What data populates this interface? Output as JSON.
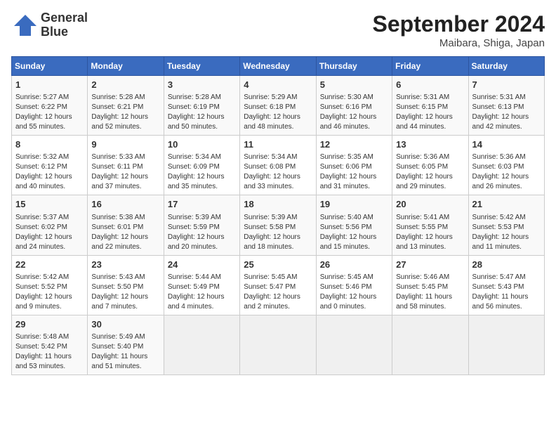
{
  "header": {
    "logo_line1": "General",
    "logo_line2": "Blue",
    "title": "September 2024",
    "subtitle": "Maibara, Shiga, Japan"
  },
  "weekdays": [
    "Sunday",
    "Monday",
    "Tuesday",
    "Wednesday",
    "Thursday",
    "Friday",
    "Saturday"
  ],
  "weeks": [
    [
      {
        "day": "1",
        "lines": [
          "Sunrise: 5:27 AM",
          "Sunset: 6:22 PM",
          "Daylight: 12 hours",
          "and 55 minutes."
        ]
      },
      {
        "day": "2",
        "lines": [
          "Sunrise: 5:28 AM",
          "Sunset: 6:21 PM",
          "Daylight: 12 hours",
          "and 52 minutes."
        ]
      },
      {
        "day": "3",
        "lines": [
          "Sunrise: 5:28 AM",
          "Sunset: 6:19 PM",
          "Daylight: 12 hours",
          "and 50 minutes."
        ]
      },
      {
        "day": "4",
        "lines": [
          "Sunrise: 5:29 AM",
          "Sunset: 6:18 PM",
          "Daylight: 12 hours",
          "and 48 minutes."
        ]
      },
      {
        "day": "5",
        "lines": [
          "Sunrise: 5:30 AM",
          "Sunset: 6:16 PM",
          "Daylight: 12 hours",
          "and 46 minutes."
        ]
      },
      {
        "day": "6",
        "lines": [
          "Sunrise: 5:31 AM",
          "Sunset: 6:15 PM",
          "Daylight: 12 hours",
          "and 44 minutes."
        ]
      },
      {
        "day": "7",
        "lines": [
          "Sunrise: 5:31 AM",
          "Sunset: 6:13 PM",
          "Daylight: 12 hours",
          "and 42 minutes."
        ]
      }
    ],
    [
      {
        "day": "8",
        "lines": [
          "Sunrise: 5:32 AM",
          "Sunset: 6:12 PM",
          "Daylight: 12 hours",
          "and 40 minutes."
        ]
      },
      {
        "day": "9",
        "lines": [
          "Sunrise: 5:33 AM",
          "Sunset: 6:11 PM",
          "Daylight: 12 hours",
          "and 37 minutes."
        ]
      },
      {
        "day": "10",
        "lines": [
          "Sunrise: 5:34 AM",
          "Sunset: 6:09 PM",
          "Daylight: 12 hours",
          "and 35 minutes."
        ]
      },
      {
        "day": "11",
        "lines": [
          "Sunrise: 5:34 AM",
          "Sunset: 6:08 PM",
          "Daylight: 12 hours",
          "and 33 minutes."
        ]
      },
      {
        "day": "12",
        "lines": [
          "Sunrise: 5:35 AM",
          "Sunset: 6:06 PM",
          "Daylight: 12 hours",
          "and 31 minutes."
        ]
      },
      {
        "day": "13",
        "lines": [
          "Sunrise: 5:36 AM",
          "Sunset: 6:05 PM",
          "Daylight: 12 hours",
          "and 29 minutes."
        ]
      },
      {
        "day": "14",
        "lines": [
          "Sunrise: 5:36 AM",
          "Sunset: 6:03 PM",
          "Daylight: 12 hours",
          "and 26 minutes."
        ]
      }
    ],
    [
      {
        "day": "15",
        "lines": [
          "Sunrise: 5:37 AM",
          "Sunset: 6:02 PM",
          "Daylight: 12 hours",
          "and 24 minutes."
        ]
      },
      {
        "day": "16",
        "lines": [
          "Sunrise: 5:38 AM",
          "Sunset: 6:01 PM",
          "Daylight: 12 hours",
          "and 22 minutes."
        ]
      },
      {
        "day": "17",
        "lines": [
          "Sunrise: 5:39 AM",
          "Sunset: 5:59 PM",
          "Daylight: 12 hours",
          "and 20 minutes."
        ]
      },
      {
        "day": "18",
        "lines": [
          "Sunrise: 5:39 AM",
          "Sunset: 5:58 PM",
          "Daylight: 12 hours",
          "and 18 minutes."
        ]
      },
      {
        "day": "19",
        "lines": [
          "Sunrise: 5:40 AM",
          "Sunset: 5:56 PM",
          "Daylight: 12 hours",
          "and 15 minutes."
        ]
      },
      {
        "day": "20",
        "lines": [
          "Sunrise: 5:41 AM",
          "Sunset: 5:55 PM",
          "Daylight: 12 hours",
          "and 13 minutes."
        ]
      },
      {
        "day": "21",
        "lines": [
          "Sunrise: 5:42 AM",
          "Sunset: 5:53 PM",
          "Daylight: 12 hours",
          "and 11 minutes."
        ]
      }
    ],
    [
      {
        "day": "22",
        "lines": [
          "Sunrise: 5:42 AM",
          "Sunset: 5:52 PM",
          "Daylight: 12 hours",
          "and 9 minutes."
        ]
      },
      {
        "day": "23",
        "lines": [
          "Sunrise: 5:43 AM",
          "Sunset: 5:50 PM",
          "Daylight: 12 hours",
          "and 7 minutes."
        ]
      },
      {
        "day": "24",
        "lines": [
          "Sunrise: 5:44 AM",
          "Sunset: 5:49 PM",
          "Daylight: 12 hours",
          "and 4 minutes."
        ]
      },
      {
        "day": "25",
        "lines": [
          "Sunrise: 5:45 AM",
          "Sunset: 5:47 PM",
          "Daylight: 12 hours",
          "and 2 minutes."
        ]
      },
      {
        "day": "26",
        "lines": [
          "Sunrise: 5:45 AM",
          "Sunset: 5:46 PM",
          "Daylight: 12 hours",
          "and 0 minutes."
        ]
      },
      {
        "day": "27",
        "lines": [
          "Sunrise: 5:46 AM",
          "Sunset: 5:45 PM",
          "Daylight: 11 hours",
          "and 58 minutes."
        ]
      },
      {
        "day": "28",
        "lines": [
          "Sunrise: 5:47 AM",
          "Sunset: 5:43 PM",
          "Daylight: 11 hours",
          "and 56 minutes."
        ]
      }
    ],
    [
      {
        "day": "29",
        "lines": [
          "Sunrise: 5:48 AM",
          "Sunset: 5:42 PM",
          "Daylight: 11 hours",
          "and 53 minutes."
        ]
      },
      {
        "day": "30",
        "lines": [
          "Sunrise: 5:49 AM",
          "Sunset: 5:40 PM",
          "Daylight: 11 hours",
          "and 51 minutes."
        ]
      },
      null,
      null,
      null,
      null,
      null
    ]
  ]
}
